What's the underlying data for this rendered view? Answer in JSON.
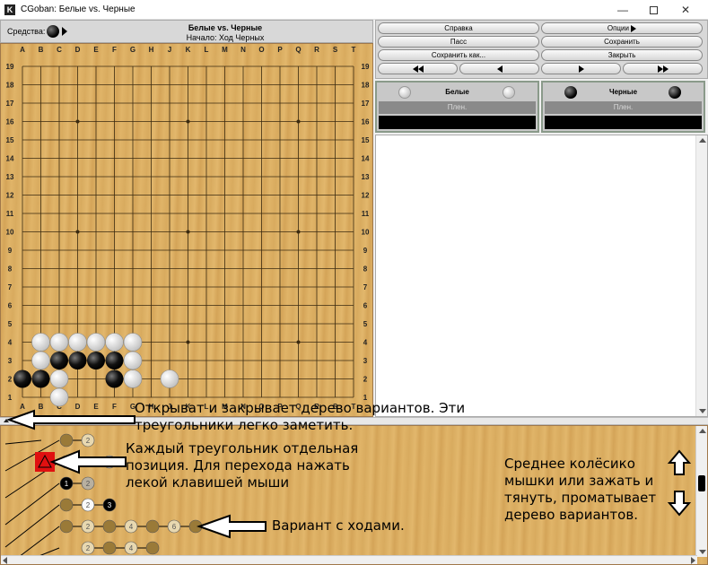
{
  "window": {
    "title": "CGoban: Белые vs. Черные",
    "app_icon": "K"
  },
  "header": {
    "tools_label": "Средства:",
    "title": "Белые vs. Черные",
    "subtitle": "Начало: Ход Черных"
  },
  "board": {
    "size": 19,
    "columns": [
      "A",
      "B",
      "C",
      "D",
      "E",
      "F",
      "G",
      "H",
      "J",
      "K",
      "L",
      "M",
      "N",
      "O",
      "P",
      "Q",
      "R",
      "S",
      "T"
    ],
    "rows": [
      19,
      18,
      17,
      16,
      15,
      14,
      13,
      12,
      11,
      10,
      9,
      8,
      7,
      6,
      5,
      4,
      3,
      2,
      1
    ],
    "star_points": [
      [
        4,
        16
      ],
      [
        10,
        16
      ],
      [
        16,
        16
      ],
      [
        4,
        10
      ],
      [
        10,
        10
      ],
      [
        16,
        10
      ],
      [
        4,
        4
      ],
      [
        10,
        4
      ],
      [
        16,
        4
      ]
    ],
    "stones": {
      "white": [
        [
          2,
          4
        ],
        [
          3,
          4
        ],
        [
          4,
          4
        ],
        [
          5,
          4
        ],
        [
          6,
          4
        ],
        [
          7,
          4
        ],
        [
          2,
          3
        ],
        [
          7,
          3
        ],
        [
          3,
          2
        ],
        [
          7,
          2
        ],
        [
          9,
          2
        ],
        [
          3,
          1
        ]
      ],
      "black": [
        [
          3,
          3
        ],
        [
          4,
          3
        ],
        [
          5,
          3
        ],
        [
          6,
          3
        ],
        [
          1,
          2
        ],
        [
          2,
          2
        ],
        [
          6,
          2
        ]
      ]
    },
    "colors": {
      "wood": "#dcae62",
      "line": "#3a2a10"
    }
  },
  "buttons": {
    "help": "Справка",
    "options": "Опции",
    "pass": "Пасс",
    "save": "Сохранить",
    "save_as": "Сохранить как...",
    "close": "Закрыть"
  },
  "players": {
    "white": {
      "name": "Белые",
      "bar": "Плен."
    },
    "black": {
      "name": "Черные",
      "bar": "Плен."
    }
  },
  "tree": {
    "row_labels": [
      "A",
      "B",
      "C",
      "D",
      "E",
      "F"
    ],
    "nodes": [
      {
        "col": 3,
        "row": 0,
        "color": "gold",
        "label": ""
      },
      {
        "col": 4,
        "row": 0,
        "color": "light",
        "label": "2"
      },
      {
        "col": 2,
        "row": 1,
        "color": "red",
        "label": ""
      },
      {
        "col": 3,
        "row": 1,
        "color": "gold",
        "label": ""
      },
      {
        "col": 5,
        "row": 1,
        "color": "gray",
        "label": "2"
      },
      {
        "col": 3,
        "row": 2,
        "color": "black",
        "label": "1"
      },
      {
        "col": 4,
        "row": 2,
        "color": "gray",
        "label": "2"
      },
      {
        "col": 3,
        "row": 3,
        "color": "gold",
        "label": ""
      },
      {
        "col": 4,
        "row": 3,
        "color": "white",
        "label": "2"
      },
      {
        "col": 5,
        "row": 3,
        "color": "black",
        "label": "3"
      },
      {
        "col": 3,
        "row": 4,
        "color": "gold",
        "label": ""
      },
      {
        "col": 4,
        "row": 4,
        "color": "light",
        "label": "2"
      },
      {
        "col": 5,
        "row": 4,
        "color": "gold",
        "label": ""
      },
      {
        "col": 6,
        "row": 4,
        "color": "light",
        "label": "4"
      },
      {
        "col": 7,
        "row": 4,
        "color": "gold",
        "label": ""
      },
      {
        "col": 8,
        "row": 4,
        "color": "light",
        "label": "6"
      },
      {
        "col": 9,
        "row": 4,
        "color": "gold",
        "label": ""
      },
      {
        "col": 4,
        "row": 5,
        "color": "light",
        "label": "2"
      },
      {
        "col": 5,
        "row": 5,
        "color": "gold",
        "label": ""
      },
      {
        "col": 6,
        "row": 5,
        "color": "light",
        "label": "4"
      },
      {
        "col": 7,
        "row": 5,
        "color": "gold",
        "label": ""
      }
    ]
  },
  "annotations": {
    "a1": "Открыват и закрывает дерево вариантов. Эти треугольники легко заметить.",
    "a2": "Каждый треугольник отдельная позиция. Для перехода нажать лекой клавишей мыши",
    "a3": "Вариант с ходами.",
    "a4": "Среднее колёсико мышки или зажать и тянуть, проматывает дерево вариантов."
  }
}
